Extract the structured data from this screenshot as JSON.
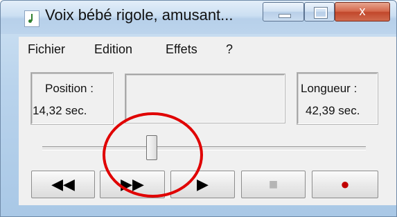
{
  "window": {
    "title": "Voix bébé rigole, amusant...",
    "icon": "sound-recorder-icon"
  },
  "window_controls": {
    "minimize_icon": "minimize-icon",
    "maximize_icon": "maximize-icon",
    "close_icon": "close-icon",
    "close_glyph": "x"
  },
  "menu": {
    "items": [
      "Fichier",
      "Edition",
      "Effets",
      "?"
    ]
  },
  "position": {
    "label": "Position :",
    "value": "14,32 sec."
  },
  "length": {
    "label": "Longueur :",
    "value": "42,39 sec."
  },
  "slider": {
    "fraction": 0.338
  },
  "controls": {
    "rewind": {
      "icon": "rewind-icon",
      "glyph": "◀◀"
    },
    "fast_forward": {
      "icon": "fast-forward-icon",
      "glyph": "▶▶"
    },
    "play": {
      "icon": "play-icon",
      "glyph": "▶"
    },
    "stop": {
      "icon": "stop-icon",
      "glyph": "■"
    },
    "record": {
      "icon": "record-icon",
      "glyph": "●"
    }
  },
  "colors": {
    "record": "#c00000",
    "stop": "#b5b5b5",
    "annotation": "#e00000",
    "close_button": "#c1472b"
  }
}
